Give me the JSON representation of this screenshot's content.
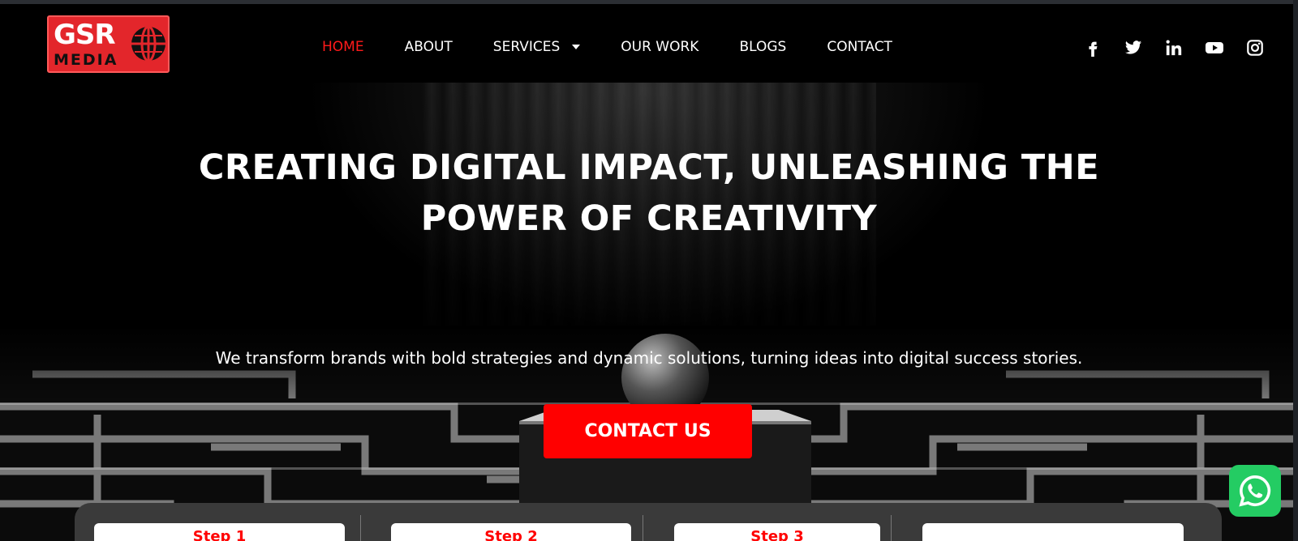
{
  "brand": {
    "name_top": "GSR",
    "name_bottom": "MEDIA",
    "accent": "#ff0000"
  },
  "nav": {
    "items": [
      {
        "label": "HOME",
        "active": true
      },
      {
        "label": "ABOUT"
      },
      {
        "label": "SERVICES",
        "has_dropdown": true
      },
      {
        "label": "OUR WORK"
      },
      {
        "label": "BLOGS"
      },
      {
        "label": "CONTACT"
      }
    ]
  },
  "socials": [
    "facebook-icon",
    "twitter-icon",
    "linkedin-icon",
    "youtube-icon",
    "instagram-icon"
  ],
  "hero": {
    "title_line1": "CREATING DIGITAL IMPACT, UNLEASHING THE",
    "title_line2": "POWER OF CREATIVITY",
    "subtitle": "We transform brands with bold strategies and dynamic solutions, turning ideas into digital success stories.",
    "cta_label": "CONTACT US"
  },
  "steps": [
    {
      "label": "Step 1"
    },
    {
      "label": "Step 2"
    },
    {
      "label": "Step 3"
    },
    {
      "label": ""
    }
  ],
  "floating": {
    "whatsapp_icon": "whatsapp-icon",
    "whatsapp_color": "#24cc63"
  }
}
